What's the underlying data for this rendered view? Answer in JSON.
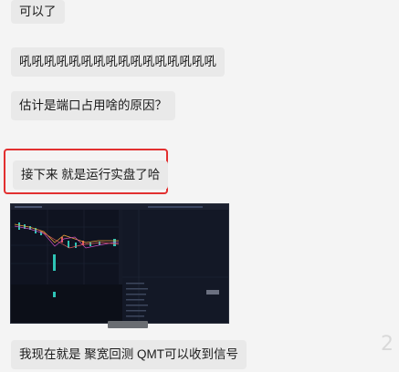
{
  "chat": {
    "messages": [
      {
        "text": "可以了"
      },
      {
        "text": "吼吼吼吼吼吼吼吼吼吼吼吼吼吼吼吼"
      },
      {
        "text": "估计是端口占用啥的原因？"
      },
      {
        "text": "接下来 就是运行实盘了哈",
        "highlighted": true
      },
      {
        "type": "image",
        "description_icon": "trading-chart-screenshot-thumbnail"
      },
      {
        "text": "我现在就是 聚宽回测  QMT可以收到信号"
      }
    ]
  },
  "colors": {
    "bubble": "#e9e9e9",
    "highlight_border": "#e23030",
    "chart_bg": "#121520",
    "candle_up": "#2ec4b6",
    "candle_down": "#e05a5a",
    "ma_line": "#e8a23a"
  }
}
